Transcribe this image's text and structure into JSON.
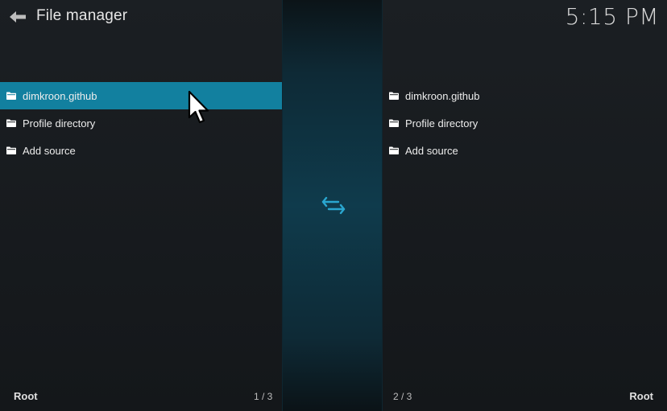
{
  "header": {
    "title": "File manager",
    "clock": "5:15 PM"
  },
  "left_pane": {
    "items": [
      {
        "label": "dimkroon.github",
        "icon": "folder-icon",
        "selected": true
      },
      {
        "label": "Profile directory",
        "icon": "folder-icon"
      },
      {
        "label": "Add source",
        "icon": "folder-icon"
      }
    ],
    "path": "Root",
    "count": "1 / 3"
  },
  "right_pane": {
    "items": [
      {
        "label": "dimkroon.github",
        "icon": "folder-icon"
      },
      {
        "label": "Profile directory",
        "icon": "folder-icon"
      },
      {
        "label": "Add source",
        "icon": "folder-icon"
      }
    ],
    "path": "Root",
    "count": "2 / 3"
  },
  "icons": {
    "back": "back-arrow-icon",
    "swap": "swap-arrows-icon",
    "pointer": "mouse-pointer-icon"
  },
  "colors": {
    "accent": "#12809f",
    "swap_icon": "#2aa6cf",
    "background": "#16191c"
  }
}
